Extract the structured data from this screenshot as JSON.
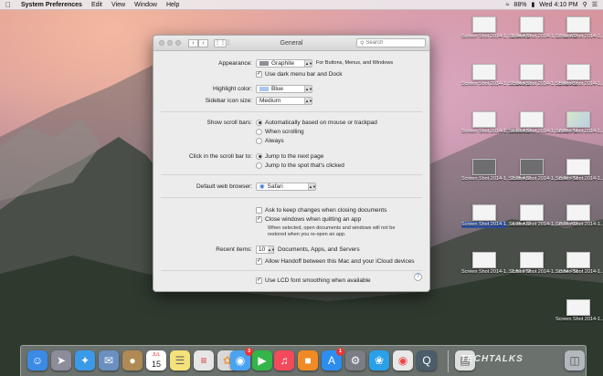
{
  "menubar": {
    "apple": "",
    "items": [
      "System Preferences",
      "Edit",
      "View",
      "Window",
      "Help"
    ],
    "battery": "88%",
    "clock": "Wed 4:10 PM"
  },
  "desktop_icons": [
    {
      "label": "Screen Shot 2014-1....1.24 AM"
    },
    {
      "label": "Screen Shot 2014-1....7.11 AM"
    },
    {
      "label": "Screen Shot 2014-1....8.58 PM"
    },
    {
      "label": "Screen Shot 2014-1....7.24 AM"
    },
    {
      "label": "Screen Shot 2014-1....5.48 AM"
    },
    {
      "label": "Screen Shot 2014-1....2.15 PM"
    },
    {
      "label": "Screen Shot 2014-1....0.01 AM"
    },
    {
      "label": "Screen Shot 2014-1....6.25 PM"
    },
    {
      "label": "Screen Shot 2014-1....3.14 AM"
    },
    {
      "label": "Screen Shot 2014-1....2.25 AM"
    },
    {
      "label": "Screen Shot 2014-1....6.07 PM"
    },
    {
      "label": "Screen Shot 2014-1....5.39 PM"
    },
    {
      "label": "Screen Shot 2014-1....4.35 AM"
    },
    {
      "label": "Screen Shot 2014-1....8.26 AM"
    },
    {
      "label": "Screen Shot 2014-1....9.26 PM"
    },
    {
      "label": "Screen Shot 2014-1....1.51 PM"
    },
    {
      "label": "Screen Shot 2014-1....0.54 PM"
    },
    {
      "label": "Screen Shot 2014-1....4.06 PM"
    },
    {
      "label": "Screen Shot 2014-1....3.42 PM"
    }
  ],
  "window": {
    "title": "General",
    "search_placeholder": "Search",
    "appearance": {
      "label": "Appearance:",
      "value": "Graphite",
      "note": "For Buttons, Menus, and Windows"
    },
    "dark_menu": {
      "label": "Use dark menu bar and Dock",
      "checked": true
    },
    "highlight": {
      "label": "Highlight color:",
      "value": "Blue"
    },
    "sidebar": {
      "label": "Sidebar icon size:",
      "value": "Medium"
    },
    "scrollbars": {
      "label": "Show scroll bars:",
      "options": [
        "Automatically based on mouse or trackpad",
        "When scrolling",
        "Always"
      ],
      "selected": 0
    },
    "click_scroll": {
      "label": "Click in the scroll bar to:",
      "options": [
        "Jump to the next page",
        "Jump to the spot that's clicked"
      ],
      "selected": 0
    },
    "browser": {
      "label": "Default web browser:",
      "value": "Safari"
    },
    "ask_keep": {
      "label": "Ask to keep changes when closing documents",
      "checked": false
    },
    "close_windows": {
      "label": "Close windows when quitting an app",
      "checked": true
    },
    "close_note_1": "When selected, open documents and windows will not be",
    "close_note_2": "restored when you re-open an app.",
    "recent": {
      "label": "Recent items:",
      "value": "10",
      "suffix": "Documents, Apps, and Servers"
    },
    "handoff": {
      "label": "Allow Handoff between this Mac and your iCloud devices",
      "checked": true
    },
    "lcd": {
      "label": "Use LCD font smoothing when available",
      "checked": true
    },
    "help": "?"
  },
  "dock": {
    "calendar_month": "JUL",
    "calendar_day": "15",
    "messages_badge": "3",
    "appstore_badge": "1",
    "watermark": "TECHTALKS"
  },
  "colors": {
    "graphite": "#8c8f96",
    "blue": "#a8c6ee",
    "accent": "#3a73d8"
  }
}
